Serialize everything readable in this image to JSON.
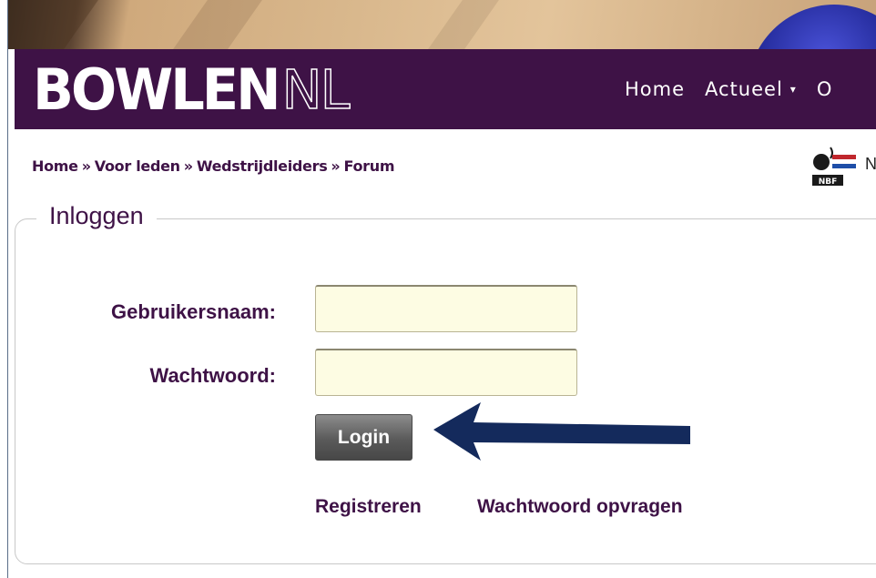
{
  "brand": {
    "logo_main": "BOWLEN",
    "logo_suffix": "NL"
  },
  "nav": {
    "items": [
      {
        "label": "Home",
        "has_caret": false
      },
      {
        "label": "Actueel",
        "has_caret": true
      },
      {
        "label": "O",
        "has_caret": false
      }
    ]
  },
  "breadcrumb": {
    "items": [
      "Home",
      "Voor leden",
      "Wedstrijdleiders",
      "Forum"
    ],
    "separator": "»"
  },
  "partner": {
    "logo_text": "NBF",
    "label_partial": "N"
  },
  "login_form": {
    "legend": "Inloggen",
    "username_label": "Gebruikersnaam:",
    "username_value": "",
    "password_label": "Wachtwoord:",
    "password_value": "",
    "submit_label": "Login",
    "register_link": "Registreren",
    "forgot_link": "Wachtwoord opvragen"
  },
  "annotation": {
    "arrow_icon": "left-arrow-icon",
    "arrow_color": "#142a5c"
  },
  "colors": {
    "brand_purple": "#3e1246",
    "input_bg": "#fdfce3",
    "button_gray": "#5a5a5a"
  }
}
